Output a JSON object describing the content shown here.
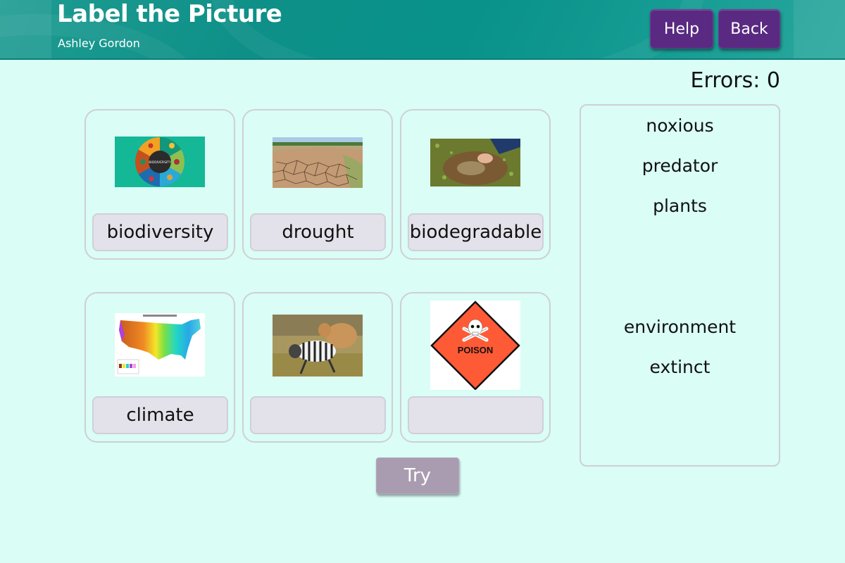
{
  "header": {
    "title": "Label the Picture",
    "author": "Ashley Gordon",
    "help_label": "Help",
    "back_label": "Back"
  },
  "status": {
    "errors_label": "Errors:",
    "errors_count": "0",
    "errors_text": "Errors: 0"
  },
  "cards": [
    {
      "image": "biodiversity-wheel-image",
      "label": "biodiversity",
      "image_text": "BIODIVERSITY"
    },
    {
      "image": "cracked-dry-riverbed-image",
      "label": "drought"
    },
    {
      "image": "hand-burying-material-in-soil-image",
      "label": "biodegradable"
    },
    {
      "image": "us-precipitation-map-image",
      "label": "climate"
    },
    {
      "image": "lion-attacking-zebra-image",
      "label": ""
    },
    {
      "image": "poison-hazard-sign-image",
      "label": "",
      "image_text": "POISON"
    }
  ],
  "word_bank": [
    {
      "word": "noxious"
    },
    {
      "word": "predator"
    },
    {
      "word": "plants"
    },
    {
      "word": ""
    },
    {
      "word": ""
    },
    {
      "word": "environment"
    },
    {
      "word": "extinct"
    }
  ],
  "actions": {
    "try_label": "Try"
  },
  "colors": {
    "header_teal": "#0e9088",
    "background": "#dafdf6",
    "header_button": "#5a2a82",
    "try_button": "#a99cb0",
    "label_slot": "#e3e1e9",
    "poison_orange": "#ff5a36"
  }
}
